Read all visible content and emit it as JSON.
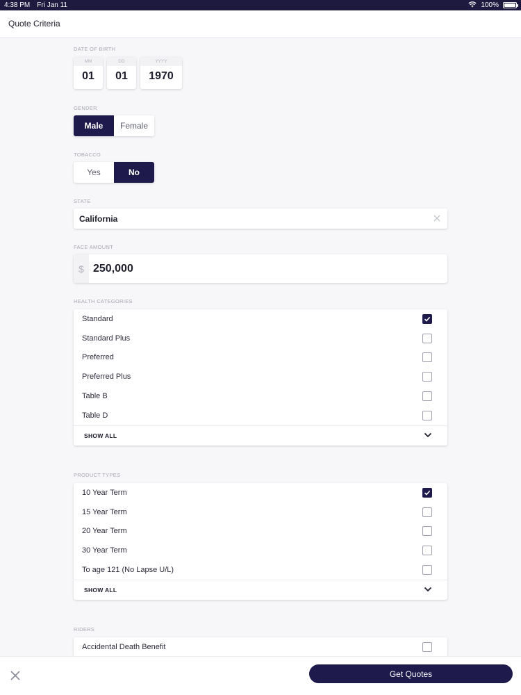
{
  "status_bar": {
    "time": "4:38 PM",
    "date": "Fri Jan 11",
    "battery": "100%",
    "battery_level": 1.0
  },
  "header": {
    "title": "Quote Criteria"
  },
  "dob": {
    "label": "DATE OF BIRTH",
    "month": {
      "placeholder": "MM",
      "value": "01"
    },
    "day": {
      "placeholder": "DD",
      "value": "01"
    },
    "year": {
      "placeholder": "YYYY",
      "value": "1970"
    }
  },
  "gender": {
    "label": "GENDER",
    "options": [
      "Male",
      "Female"
    ],
    "selected": "Male"
  },
  "tobacco": {
    "label": "TOBACCO",
    "options": [
      "Yes",
      "No"
    ],
    "selected": "No"
  },
  "state": {
    "label": "STATE",
    "value": "California"
  },
  "face_amount": {
    "label": "FACE AMOUNT",
    "currency": "$",
    "value": "250,000"
  },
  "health_categories": {
    "label": "HEALTH CATEGORIES",
    "items": [
      {
        "label": "Standard",
        "checked": true
      },
      {
        "label": "Standard Plus",
        "checked": false
      },
      {
        "label": "Preferred",
        "checked": false
      },
      {
        "label": "Preferred Plus",
        "checked": false
      },
      {
        "label": "Table B",
        "checked": false
      },
      {
        "label": "Table D",
        "checked": false
      }
    ],
    "show_all": "SHOW ALL"
  },
  "product_types": {
    "label": "PRODUCT TYPES",
    "items": [
      {
        "label": "10 Year Term",
        "checked": true
      },
      {
        "label": "15 Year Term",
        "checked": false
      },
      {
        "label": "20 Year Term",
        "checked": false
      },
      {
        "label": "30 Year Term",
        "checked": false
      },
      {
        "label": "To age 121 (No Lapse U/L)",
        "checked": false
      }
    ],
    "show_all": "SHOW ALL"
  },
  "riders": {
    "label": "RIDERS",
    "items": [
      {
        "label": "Accidental Death Benefit",
        "checked": false
      }
    ]
  },
  "footer": {
    "get_quotes_label": "Get Quotes"
  },
  "colors": {
    "accent": "#1e1a4b",
    "status_bar": "#1e1a3f",
    "background": "#f7f7f9"
  }
}
